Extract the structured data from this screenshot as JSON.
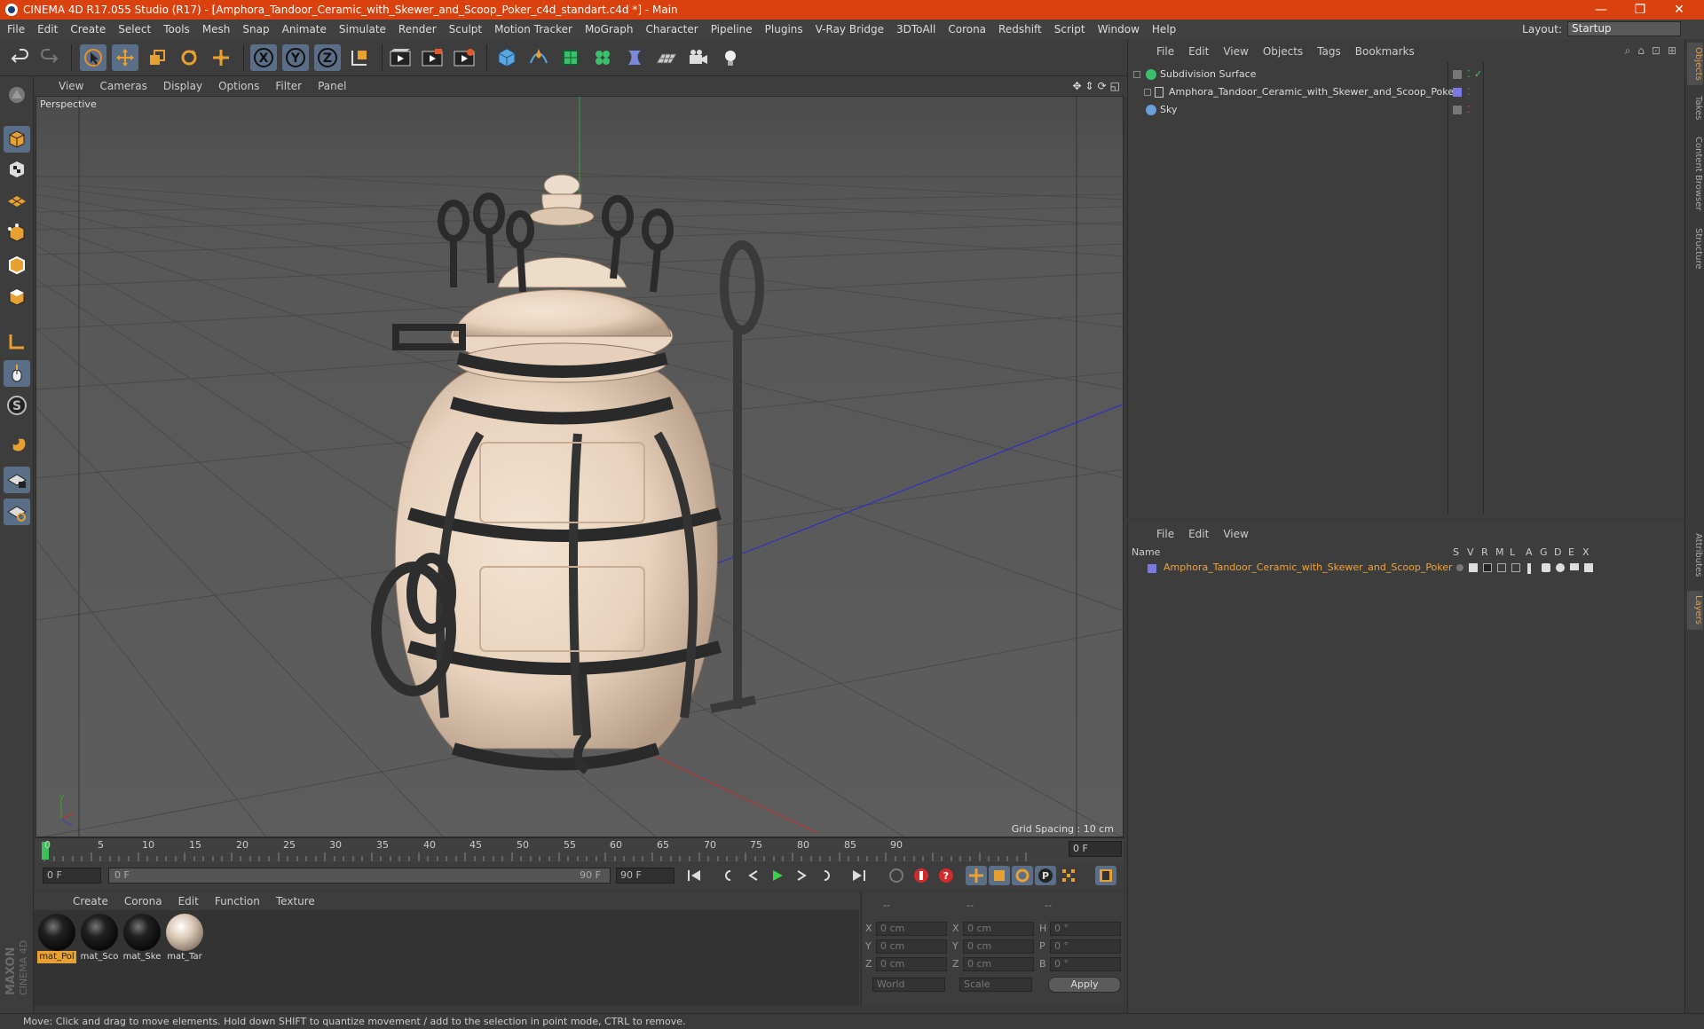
{
  "window": {
    "title": "CINEMA 4D R17.055 Studio (R17) - [Amphora_Tandoor_Ceramic_with_Skewer_and_Scoop_Poker_c4d_standart.c4d *] - Main",
    "controls": [
      "—",
      "❐",
      "✕"
    ]
  },
  "menu": {
    "items": [
      "File",
      "Edit",
      "Create",
      "Select",
      "Tools",
      "Mesh",
      "Snap",
      "Animate",
      "Simulate",
      "Render",
      "Sculpt",
      "Motion Tracker",
      "MoGraph",
      "Character",
      "Pipeline",
      "Plugins",
      "V-Ray Bridge",
      "3DToAll",
      "Corona",
      "Redshift",
      "Script",
      "Window",
      "Help"
    ],
    "layout_label": "Layout:",
    "layout_value": "Startup"
  },
  "toolbar": {
    "icons": [
      "undo-icon",
      "redo-icon",
      "live-selection-icon",
      "move-icon",
      "scale-icon",
      "rotate-icon",
      "last-tool-icon",
      "x-axis-icon",
      "y-axis-icon",
      "z-axis-icon",
      "coordinate-system-icon",
      "render-view-icon",
      "render-picture-viewer-icon",
      "edit-render-settings-icon",
      "cube-icon",
      "pen-icon",
      "subdivision-icon",
      "cloner-icon",
      "deformer-icon",
      "floor-icon",
      "camera-icon",
      "light-icon"
    ]
  },
  "viewport": {
    "menu": [
      "View",
      "Cameras",
      "Display",
      "Options",
      "Filter",
      "Panel"
    ],
    "label": "Perspective",
    "grid_spacing": "Grid Spacing : 10 cm"
  },
  "timeline": {
    "ticks": [
      "0",
      "5",
      "10",
      "15",
      "20",
      "25",
      "30",
      "35",
      "40",
      "45",
      "50",
      "55",
      "60",
      "65",
      "70",
      "75",
      "80",
      "85",
      "90"
    ],
    "current_frame": "0 F"
  },
  "transport": {
    "start": "0 F",
    "range_start": "0 F",
    "range_end": "90 F",
    "end": "90 F"
  },
  "materials": {
    "menu": [
      "Create",
      "Corona",
      "Edit",
      "Function",
      "Texture"
    ],
    "items": [
      {
        "name": "mat_Pol",
        "color": "#111111"
      },
      {
        "name": "mat_Sco",
        "color": "#111111"
      },
      {
        "name": "mat_Ske",
        "color": "#111111"
      },
      {
        "name": "mat_Tar",
        "color": "#d9c9b5"
      }
    ]
  },
  "coordinates": {
    "headers": [
      "--",
      "--",
      "--"
    ],
    "rows": [
      {
        "a": "X",
        "av": "0 cm",
        "b": "X",
        "bv": "0 cm",
        "c": "H",
        "cv": "0 °"
      },
      {
        "a": "Y",
        "av": "0 cm",
        "b": "Y",
        "bv": "0 cm",
        "c": "P",
        "cv": "0 °"
      },
      {
        "a": "Z",
        "av": "0 cm",
        "b": "Z",
        "bv": "0 cm",
        "c": "B",
        "cv": "0 °"
      }
    ],
    "mode": "World",
    "mode2": "Scale",
    "apply": "Apply"
  },
  "objects": {
    "menu": [
      "File",
      "Edit",
      "View",
      "Objects",
      "Tags",
      "Bookmarks"
    ],
    "items": [
      "Subdivision Surface",
      "Amphora_Tandoor_Ceramic_with_Skewer_and_Scoop_Poker",
      "Sky"
    ]
  },
  "layers": {
    "menu": [
      "File",
      "Edit",
      "View"
    ],
    "columns": [
      "Name",
      "S",
      "V",
      "R",
      "M",
      "L",
      "A",
      "G",
      "D",
      "E",
      "X"
    ],
    "row": "Amphora_Tandoor_Ceramic_with_Skewer_and_Scoop_Poker"
  },
  "right_tabs": [
    "Objects",
    "Takes",
    "Content Browser",
    "Structure",
    "Attributes",
    "Layers"
  ],
  "status": "Move: Click and drag to move elements. Hold down SHIFT to quantize movement / add to the selection in point mode, CTRL to remove."
}
